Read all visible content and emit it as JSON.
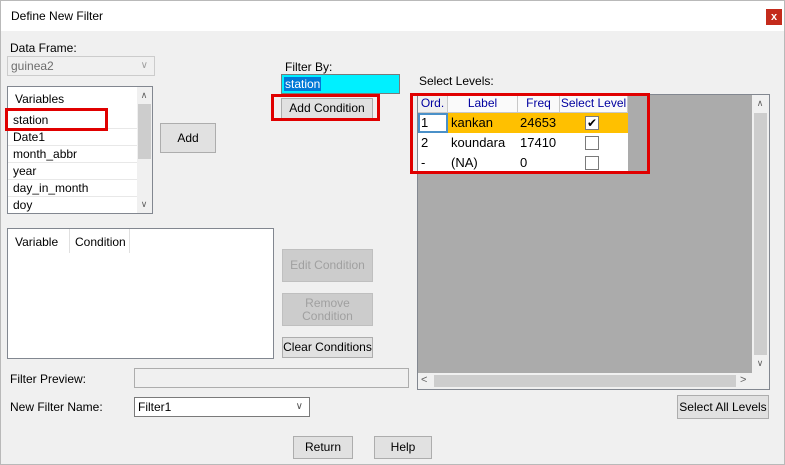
{
  "window": {
    "title": "Define New Filter",
    "close_glyph": "x"
  },
  "data_frame": {
    "label": "Data Frame:",
    "value": "guinea2"
  },
  "variables": {
    "header": "Variables",
    "items": [
      "station",
      "Date1",
      "month_abbr",
      "year",
      "day_in_month",
      "doy"
    ]
  },
  "add_button": "Add",
  "conditions_table": {
    "col_variable": "Variable",
    "col_condition": "Condition"
  },
  "filter_by": {
    "label": "Filter By:",
    "value": "station"
  },
  "add_condition_button": "Add Condition",
  "edit_condition_button": "Edit Condition",
  "remove_condition_button": "Remove Condition",
  "clear_conditions_button": "Clear Conditions",
  "select_levels": {
    "label": "Select Levels:",
    "headers": {
      "ord": "Ord.",
      "label": "Label",
      "freq": "Freq",
      "select": "Select Level"
    },
    "rows": [
      {
        "ord": "1",
        "label": "kankan",
        "freq": "24653",
        "checked": true
      },
      {
        "ord": "2",
        "label": "koundara",
        "freq": "17410",
        "checked": false
      },
      {
        "ord": "-",
        "label": "(NA)",
        "freq": "0",
        "checked": false
      }
    ],
    "selected_row_color": "#ffc000"
  },
  "filter_preview": {
    "label": "Filter Preview:",
    "value": ""
  },
  "new_filter_name": {
    "label": "New Filter Name:",
    "value": "Filter1"
  },
  "select_all_levels_button": "Select All Levels",
  "return_button": "Return",
  "help_button": "Help",
  "highlight_color": "#e00000"
}
